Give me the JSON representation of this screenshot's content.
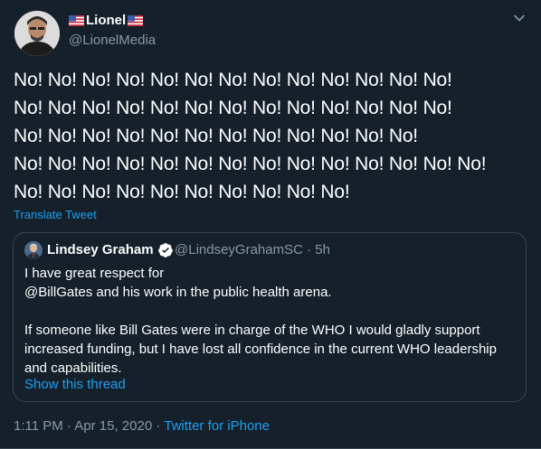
{
  "author": {
    "display_name": "Lionel",
    "handle": "@LionelMedia",
    "name_icons": [
      "us-flag-icon",
      "us-flag-icon"
    ]
  },
  "tweet": {
    "lines": [
      "No! No! No! No! No! No! No! No! No!  No! No! No! No!",
      "No! No! No! No! No!  No! No! No! No! No! No! No! No!",
      "No!  No! No! No! No! No! No! No! No!  No! No! No!",
      "No! No! No! No! No! No! No! No! No! No! No! No! No! No!",
      "No! No! No! No! No! No! No! No! No! No!"
    ],
    "translate_label": "Translate Tweet"
  },
  "quoted_tweet": {
    "display_name": "Lindsey Graham",
    "verified": true,
    "handle": "@LindseyGrahamSC",
    "time": "5h",
    "text_lines_1": [
      "I have great respect for",
      "@BillGates and his work in the public health arena."
    ],
    "text_lines_2": [
      "If someone like Bill Gates were in charge of the WHO I would gladly support",
      "increased funding, but I have lost all confidence in the current WHO leadership",
      "and capabilities."
    ],
    "show_thread_label": "Show this thread"
  },
  "meta": {
    "time": "1:11 PM",
    "date": "Apr 15, 2020",
    "source": "Twitter for iPhone"
  },
  "colors": {
    "background": "#15202b",
    "link": "#1da1f2",
    "secondary_text": "#8899a6",
    "border": "#38444d"
  }
}
